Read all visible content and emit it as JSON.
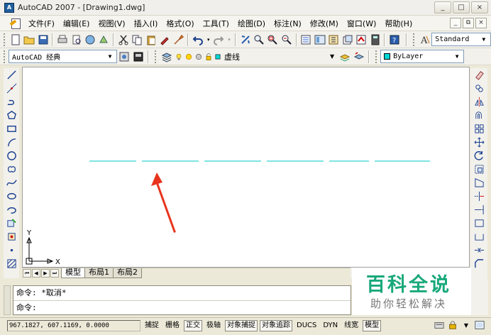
{
  "window": {
    "title": "AutoCAD 2007 - [Drawing1.dwg]",
    "app_icon_text": "A",
    "controls": [
      "_",
      "□",
      "×"
    ]
  },
  "menu": {
    "items": [
      "文件(F)",
      "编辑(E)",
      "视图(V)",
      "插入(I)",
      "格式(O)",
      "工具(T)",
      "绘图(D)",
      "标注(N)",
      "修改(M)",
      "窗口(W)",
      "帮助(H)"
    ],
    "mdi_controls": [
      "_",
      "⧉",
      "×"
    ]
  },
  "toolbar1": {
    "text_style": "Standard"
  },
  "toolbar2": {
    "workspace": "AutoCAD 经典",
    "layer": "虚线",
    "color": "ByLayer"
  },
  "canvas": {
    "line_color": "#00c8c8",
    "annotation_color": "#e8341c",
    "ucs_x": "X",
    "ucs_y": "Y"
  },
  "tabs": {
    "items": [
      "模型",
      "布局1",
      "布局2"
    ],
    "active": "模型",
    "nav": [
      "⏮",
      "◀",
      "▶",
      "⏭"
    ]
  },
  "command": {
    "lines": [
      "命令: *取消*",
      "命令:"
    ]
  },
  "watermark": {
    "title": "百科全说",
    "subtitle": "助你轻松解决"
  },
  "statusbar": {
    "coordinates": "967.1827, 607.1169, 0.0000",
    "buttons": [
      {
        "label": "捕捉",
        "on": false
      },
      {
        "label": "栅格",
        "on": false
      },
      {
        "label": "正交",
        "on": true
      },
      {
        "label": "极轴",
        "on": false
      },
      {
        "label": "对象捕捉",
        "on": true
      },
      {
        "label": "对象追踪",
        "on": true
      },
      {
        "label": "DUCS",
        "on": false
      },
      {
        "label": "DYN",
        "on": false
      },
      {
        "label": "线宽",
        "on": false
      },
      {
        "label": "模型",
        "on": true
      }
    ]
  }
}
